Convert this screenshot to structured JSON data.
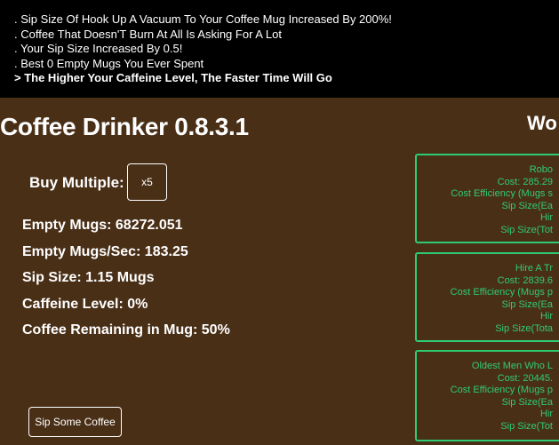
{
  "log": {
    "lines": [
      ". Sip Size Of Hook Up A Vacuum To Your Coffee Mug Increased By 200%!",
      ". Coffee That Doesn'T Burn At All Is Asking For A Lot",
      ". Your Sip Size Increased By 0.5!",
      ". Best 0 Empty Mugs You Ever Spent"
    ],
    "current": "> The Higher Your Caffeine Level, The Faster Time Will Go"
  },
  "app": {
    "title": "Coffee Drinker 0.8.3.1",
    "right_title": "Wo"
  },
  "buy": {
    "label": "Buy Multiple:",
    "value": "x5"
  },
  "stats": {
    "empty_mugs": "Empty Mugs: 68272.051",
    "empty_mugs_sec": "Empty Mugs/Sec: 183.25",
    "sip_size": "Sip Size: 1.15 Mugs",
    "caffeine": "Caffeine Level: 0%",
    "coffee_remaining": "Coffee Remaining in Mug: 50%"
  },
  "actions": {
    "sip_label": "Sip Some Coffee"
  },
  "upgrades": [
    {
      "name": "Robo",
      "cost": "Cost: 285.29",
      "efficiency": "Cost Efficiency (Mugs s",
      "sip_each": "Sip Size(Ea",
      "hired": "Hir",
      "sip_total": "Sip Size(Tot"
    },
    {
      "name": "Hire A Tr",
      "cost": "Cost: 2839.6",
      "efficiency": "Cost Efficiency (Mugs p",
      "sip_each": "Sip Size(Ea",
      "hired": "Hir",
      "sip_total": "Sip Size(Tota"
    },
    {
      "name": "Oldest Men Who L",
      "cost": "Cost: 20445.",
      "efficiency": "Cost Efficiency (Mugs p",
      "sip_each": "Sip Size(Ea",
      "hired": "Hir",
      "sip_total": "Sip Size(Tot"
    }
  ],
  "colors": {
    "background": "#4a2f17",
    "log_background": "#000000",
    "accent": "#2ecc71"
  }
}
